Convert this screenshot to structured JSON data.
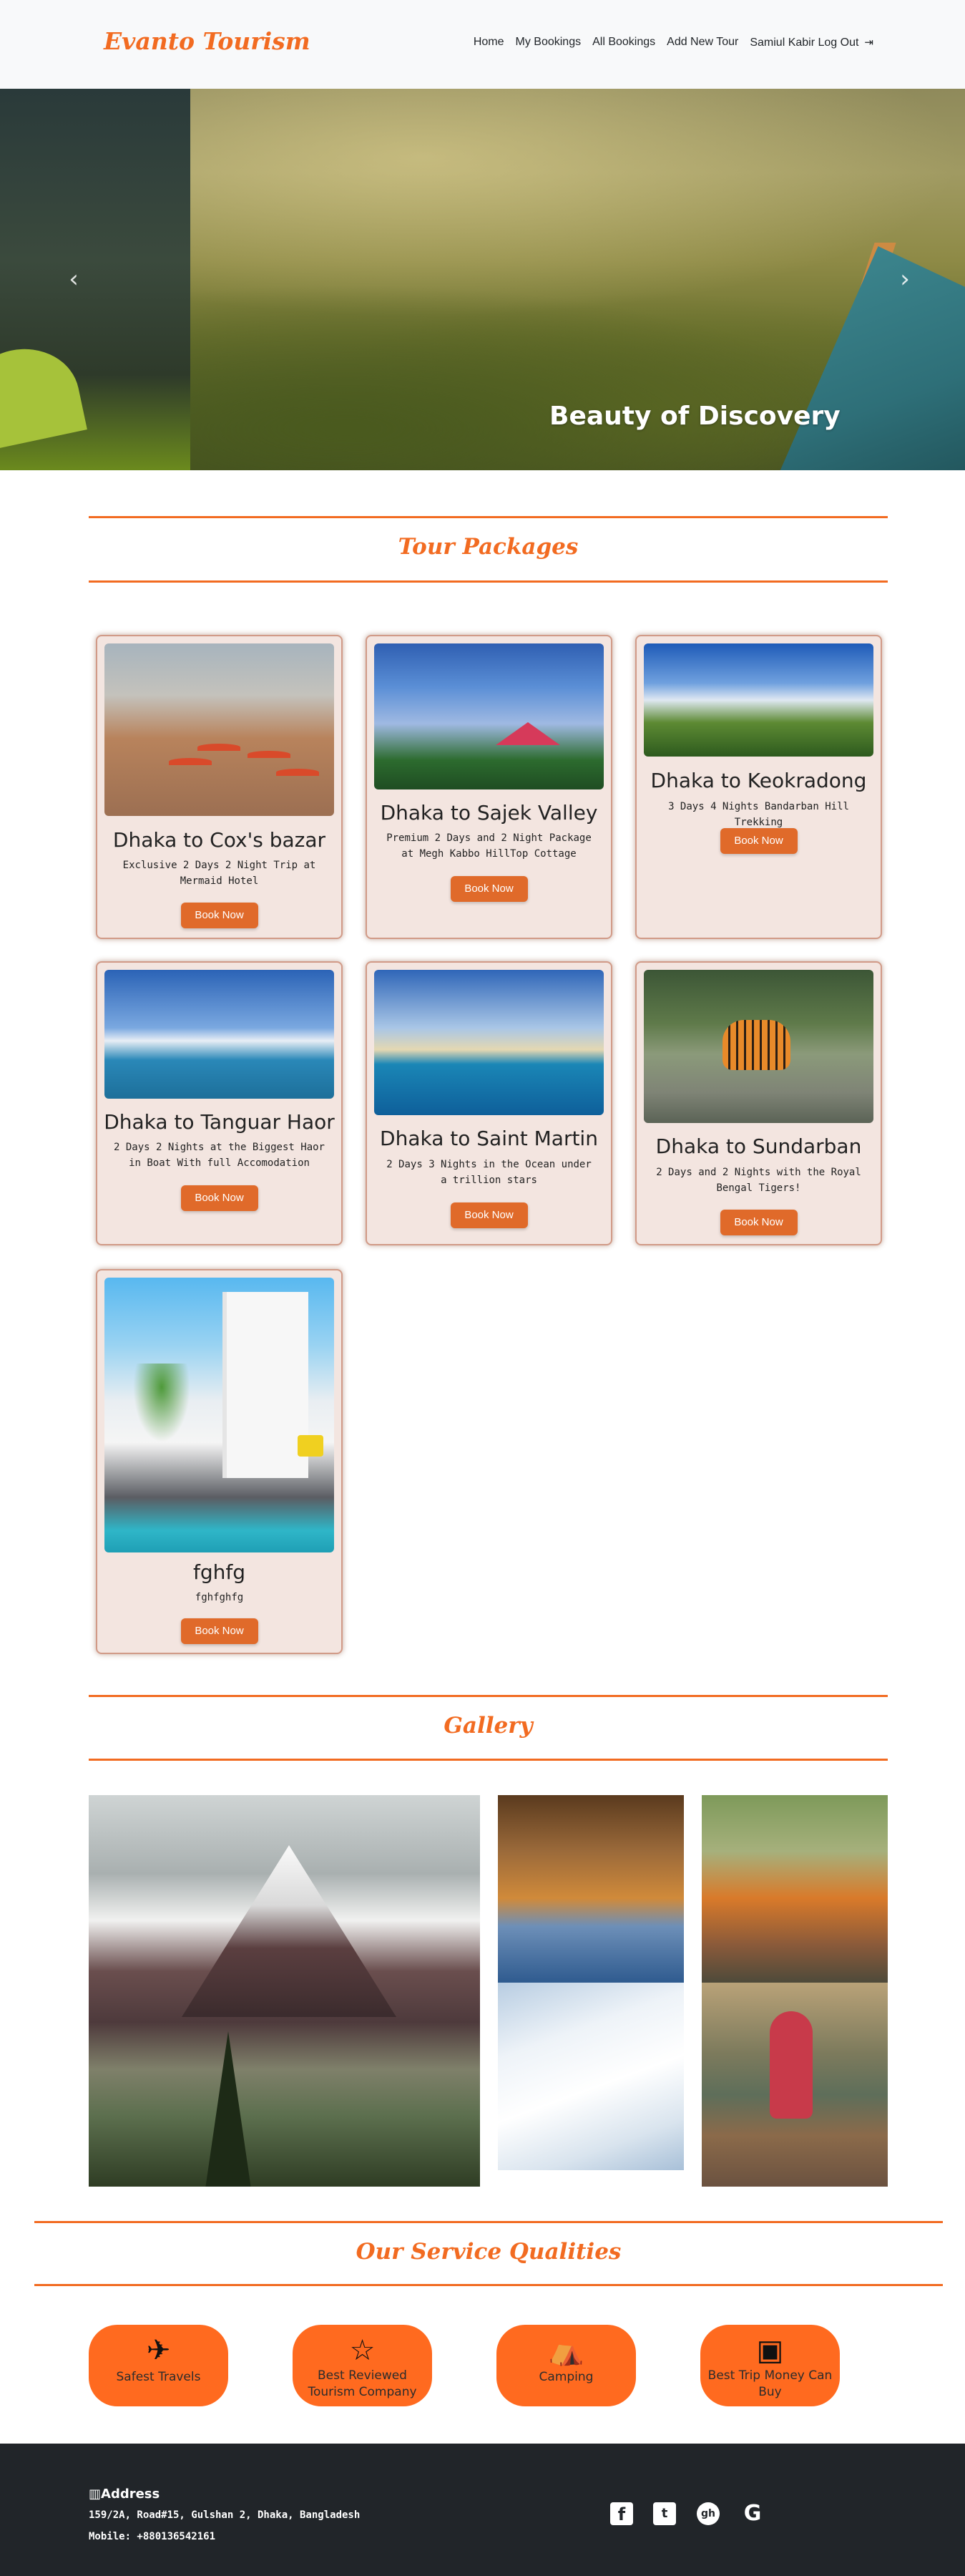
{
  "nav": {
    "brand": "Evanto Tourism",
    "links": [
      "Home",
      "My Bookings",
      "All Bookings",
      "Add New Tour",
      "Samiul Kabir Log Out"
    ],
    "logout_icon": "sign-out-icon"
  },
  "hero": {
    "caption": "Beauty of Discovery",
    "prev_icon": "‹",
    "next_icon": "›"
  },
  "packages": {
    "heading": "Tour Packages",
    "button_label": "Book Now",
    "cards": [
      {
        "title": "Dhaka to Cox's bazar",
        "desc": "Exclusive 2 Days 2 Night Trip at Mermaid Hotel"
      },
      {
        "title": "Dhaka to Sajek Valley",
        "desc": "Premium 2 Days and 2 Night Package at Megh Kabbo HillTop Cottage"
      },
      {
        "title": "Dhaka to Keokradong",
        "desc": "3 Days 4 Nights Bandarban Hill Trekking"
      },
      {
        "title": "Dhaka to Tanguar Haor",
        "desc": "2 Days 2 Nights at the Biggest Haor in Boat With full Accomodation"
      },
      {
        "title": "Dhaka to Saint Martin",
        "desc": "2 Days 3 Nights in the Ocean under a trillion stars"
      },
      {
        "title": "Dhaka to Sundarban",
        "desc": "2 Days and 2 Nights with the Royal Bengal Tigers!"
      },
      {
        "title": "fghfg",
        "desc": "fghfghfg"
      }
    ]
  },
  "gallery": {
    "heading": "Gallery"
  },
  "services": {
    "heading": "Our Service Qualities",
    "items": [
      {
        "label": "Safest Travels",
        "icon": "plane-icon",
        "glyph": "✈"
      },
      {
        "label": "Best Reviewed Tourism Company",
        "icon": "star-icon",
        "glyph": "☆"
      },
      {
        "label": "Camping",
        "icon": "tent-icon",
        "glyph": "⛺"
      },
      {
        "label": "Best Trip Money Can Buy",
        "icon": "money-icon",
        "glyph": "▣"
      }
    ]
  },
  "footer": {
    "address_title": "Address",
    "address_line": "159/2A, Road#15, Gulshan 2, Dhaka, Bangladesh",
    "mobile": "Mobile: +880136542161",
    "social": {
      "facebook": "f",
      "twitter": "t",
      "github": "gh",
      "google": "G"
    }
  },
  "colors": {
    "accent": "#f26b21",
    "button": "#e06a2a",
    "pill": "#ff6a1f",
    "footer_bg": "#212529"
  }
}
